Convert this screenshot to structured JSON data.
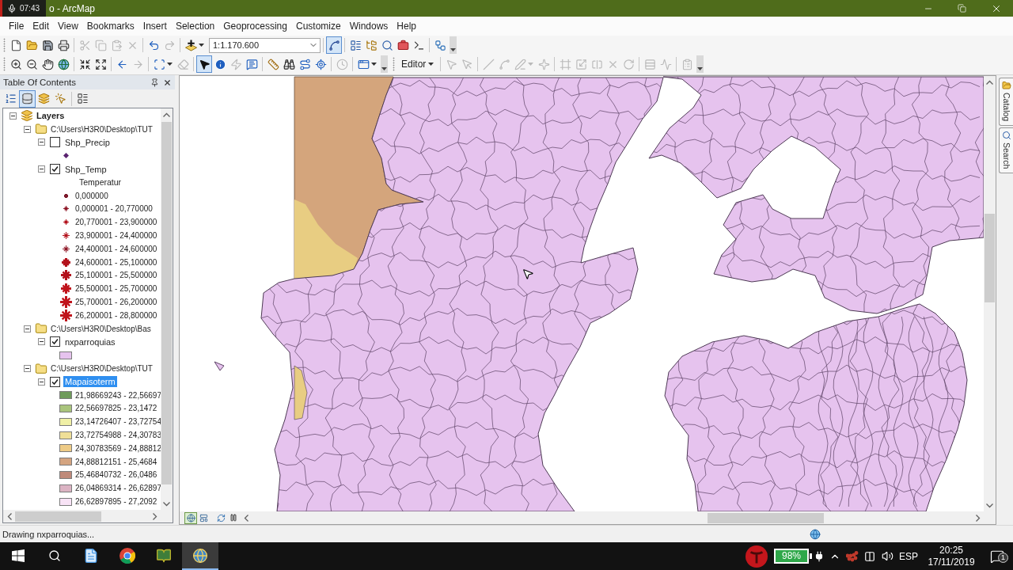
{
  "title_bar": {
    "recorder_time": "07:43",
    "title": "o - ArcMap"
  },
  "menu_bar": [
    "File",
    "Edit",
    "View",
    "Bookmarks",
    "Insert",
    "Selection",
    "Geoprocessing",
    "Customize",
    "Windows",
    "Help"
  ],
  "standard_toolbar": {
    "groups_left": [
      [
        {
          "kind": "new",
          "disabled": false,
          "pressed": false
        },
        {
          "kind": "open",
          "disabled": false,
          "pressed": false
        },
        {
          "kind": "save",
          "disabled": false,
          "pressed": false
        },
        {
          "kind": "print",
          "disabled": false,
          "pressed": false
        }
      ],
      [
        {
          "kind": "cut",
          "disabled": true,
          "pressed": false
        },
        {
          "kind": "copy",
          "disabled": true,
          "pressed": false
        },
        {
          "kind": "paste",
          "disabled": true,
          "pressed": false
        },
        {
          "kind": "delete",
          "disabled": true,
          "pressed": false
        }
      ],
      [
        {
          "kind": "undo",
          "disabled": false,
          "pressed": false
        },
        {
          "kind": "redo",
          "disabled": true,
          "pressed": false
        }
      ],
      [
        {
          "kind": "add-data",
          "disabled": false,
          "pressed": false
        }
      ]
    ],
    "scale": "1:1.170.600",
    "groups_right": [
      [
        {
          "kind": "editor-toolbar",
          "disabled": false,
          "pressed": true
        }
      ],
      [
        {
          "kind": "table-of-contents",
          "disabled": false,
          "pressed": false
        },
        {
          "kind": "catalog",
          "disabled": false,
          "pressed": false
        },
        {
          "kind": "search",
          "disabled": false,
          "pressed": false
        },
        {
          "kind": "toolbox",
          "disabled": false,
          "pressed": false
        },
        {
          "kind": "python",
          "disabled": false,
          "pressed": false
        }
      ],
      [
        {
          "kind": "model-builder",
          "disabled": false,
          "pressed": false
        }
      ]
    ]
  },
  "tools_toolbar": {
    "groups": [
      [
        {
          "kind": "zoom-in",
          "disabled": false,
          "pressed": false
        },
        {
          "kind": "zoom-out",
          "disabled": false,
          "pressed": false
        },
        {
          "kind": "pan",
          "disabled": false,
          "pressed": false
        },
        {
          "kind": "full-extent",
          "disabled": false,
          "pressed": false
        }
      ],
      [
        {
          "kind": "fixed-zoom-in",
          "disabled": false,
          "pressed": false
        },
        {
          "kind": "fixed-zoom-out",
          "disabled": false,
          "pressed": false
        }
      ],
      [
        {
          "kind": "back",
          "disabled": false,
          "pressed": false
        },
        {
          "kind": "forward",
          "disabled": true,
          "pressed": false
        }
      ],
      [
        {
          "kind": "select-features",
          "disabled": false,
          "pressed": false
        },
        {
          "kind": "clear-selection",
          "disabled": true,
          "pressed": false
        }
      ],
      [
        {
          "kind": "select-elements",
          "disabled": false,
          "pressed": true
        },
        {
          "kind": "identify",
          "disabled": false,
          "pressed": false
        },
        {
          "kind": "hyperlink",
          "disabled": true,
          "pressed": false
        },
        {
          "kind": "html-popup",
          "disabled": false,
          "pressed": false
        }
      ],
      [
        {
          "kind": "measure",
          "disabled": false,
          "pressed": false
        },
        {
          "kind": "find",
          "disabled": false,
          "pressed": false
        },
        {
          "kind": "find-route",
          "disabled": false,
          "pressed": false
        },
        {
          "kind": "go-to-xy",
          "disabled": false,
          "pressed": false
        }
      ],
      [
        {
          "kind": "time-slider",
          "disabled": true,
          "pressed": false
        }
      ],
      [
        {
          "kind": "viewer-window",
          "disabled": false,
          "pressed": false
        }
      ]
    ]
  },
  "editor_toolbar": {
    "menu": "Editor",
    "groups": [
      [
        {
          "kind": "edit-tool",
          "disabled": true,
          "pressed": false
        },
        {
          "kind": "edit-annotation",
          "disabled": true,
          "pressed": false
        }
      ],
      [
        {
          "kind": "straight-segment",
          "disabled": true,
          "pressed": false
        },
        {
          "kind": "end-point-arc",
          "disabled": true,
          "pressed": false
        },
        {
          "kind": "trace",
          "disabled": true,
          "pressed": false
        },
        {
          "kind": "midpoint",
          "disabled": true,
          "pressed": false
        }
      ],
      [
        {
          "kind": "edit-vertices",
          "disabled": true,
          "pressed": false
        },
        {
          "kind": "reshape",
          "disabled": true,
          "pressed": false
        },
        {
          "kind": "cut-polygons",
          "disabled": true,
          "pressed": false
        },
        {
          "kind": "split",
          "disabled": true,
          "pressed": false
        },
        {
          "kind": "rotate",
          "disabled": true,
          "pressed": false
        }
      ],
      [
        {
          "kind": "attributes",
          "disabled": true,
          "pressed": false
        },
        {
          "kind": "sketch-properties",
          "disabled": true,
          "pressed": false
        }
      ],
      [
        {
          "kind": "create-features",
          "disabled": true,
          "pressed": false
        }
      ]
    ]
  },
  "table_of_contents": {
    "title": "Table Of Contents",
    "views": [
      {
        "kind": "drawing-order",
        "selected": false
      },
      {
        "kind": "source",
        "selected": true
      },
      {
        "kind": "visibility",
        "selected": false
      },
      {
        "kind": "selection",
        "selected": false
      },
      {
        "kind": "options",
        "selected": false
      }
    ],
    "tree": [
      {
        "kind": "data-frame",
        "label": "Layers",
        "expanded": true,
        "selected": false,
        "children": [
          {
            "kind": "folder",
            "label": "C:\\Users\\H3R0\\Desktop\\TUT",
            "expanded": true,
            "selected": false,
            "children": [
              {
                "kind": "layer",
                "label": "Shp_Precip",
                "expanded": true,
                "checked": false,
                "selected": false,
                "legend": [
                  {
                    "kind": "diamond",
                    "color": "#5b2470"
                  }
                ]
              },
              {
                "kind": "layer",
                "label": "Shp_Temp",
                "expanded": true,
                "checked": true,
                "selected": false,
                "legend_heading": "Temperatur",
                "legend": [
                  {
                    "kind": "star",
                    "label": "0,000000",
                    "color": "#7d1a2c"
                  },
                  {
                    "kind": "star",
                    "label": "0,000001 - 20,770000",
                    "color": "#8e1626"
                  },
                  {
                    "kind": "star",
                    "label": "20,770001 - 23,900000",
                    "color": "#b3121c"
                  },
                  {
                    "kind": "star",
                    "label": "23,900001 - 24,400000",
                    "color": "#b3121c"
                  },
                  {
                    "kind": "star",
                    "label": "24,400001 - 24,600000",
                    "color": "#8e1626"
                  },
                  {
                    "kind": "star",
                    "label": "24,600001 - 25,100000",
                    "color": "#b3121c"
                  },
                  {
                    "kind": "star",
                    "label": "25,100001 - 25,500000",
                    "color": "#b3121c"
                  },
                  {
                    "kind": "star",
                    "label": "25,500001 - 25,700000",
                    "color": "#c0141c"
                  },
                  {
                    "kind": "star",
                    "label": "25,700001 - 26,200000",
                    "color": "#c0141c"
                  },
                  {
                    "kind": "star",
                    "label": "26,200001 - 28,800000",
                    "color": "#c0141c"
                  }
                ]
              }
            ]
          },
          {
            "kind": "folder",
            "label": "C:\\Users\\H3R0\\Desktop\\Bas",
            "expanded": true,
            "selected": false,
            "children": [
              {
                "kind": "layer",
                "label": "nxparroquias",
                "expanded": true,
                "checked": true,
                "selected": false,
                "legend": [
                  {
                    "kind": "swatch",
                    "color": "#e6c3ee"
                  }
                ]
              }
            ]
          },
          {
            "kind": "folder",
            "label": "C:\\Users\\H3R0\\Desktop\\TUT",
            "expanded": true,
            "selected": false,
            "children": [
              {
                "kind": "layer",
                "label": "Mapaisoterm",
                "expanded": true,
                "checked": true,
                "selected": true,
                "legend": [
                  {
                    "kind": "swatch",
                    "label": "21,98669243 - 22,56697",
                    "color": "#6f9b5b"
                  },
                  {
                    "kind": "swatch",
                    "label": "22,56697825 - 23,1472",
                    "color": "#a9c47c"
                  },
                  {
                    "kind": "swatch",
                    "label": "23,14726407 - 23,72754",
                    "color": "#f0f0a6"
                  },
                  {
                    "kind": "swatch",
                    "label": "23,72754988 - 24,30783",
                    "color": "#efdf97"
                  },
                  {
                    "kind": "swatch",
                    "label": "24,30783569 - 24,88812",
                    "color": "#eecb86"
                  },
                  {
                    "kind": "swatch",
                    "label": "24,88812151 - 25,4684",
                    "color": "#d4a480"
                  },
                  {
                    "kind": "swatch",
                    "label": "25,46840732 - 26,0486",
                    "color": "#bf8a7a"
                  },
                  {
                    "kind": "swatch",
                    "label": "26,04869314 - 26,62897",
                    "color": "#dbb3c3"
                  },
                  {
                    "kind": "swatch",
                    "label": "26,62897895 - 27,2092",
                    "color": "#f8e3f6"
                  }
                ]
              }
            ]
          }
        ]
      }
    ]
  },
  "map": {
    "view_buttons": [
      {
        "kind": "data-view",
        "selected": true
      },
      {
        "kind": "layout-view",
        "selected": false
      }
    ]
  },
  "dock_tabs": [
    {
      "kind": "catalog",
      "label": "Catalog"
    },
    {
      "kind": "search",
      "label": "Search"
    }
  ],
  "status_bar": {
    "message": "Drawing nxparroquias..."
  },
  "taskbar": {
    "apps": [
      {
        "kind": "start",
        "selected": false
      },
      {
        "kind": "search",
        "selected": false
      },
      {
        "kind": "document-app",
        "selected": false
      },
      {
        "kind": "browser",
        "selected": false
      },
      {
        "kind": "catalog-app",
        "selected": false
      },
      {
        "kind": "map-app",
        "selected": true
      }
    ],
    "battery": "98%",
    "language": "ESP",
    "time": "20:25",
    "date": "17/11/2019",
    "notifications": "1"
  }
}
